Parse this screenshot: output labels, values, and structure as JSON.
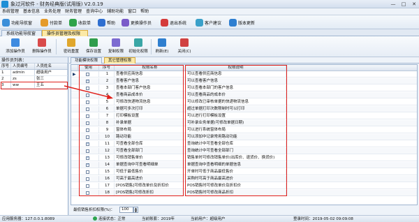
{
  "window": {
    "title": "象过河软件 - 财务经典版(试用版) V2.0.19",
    "minimize": "—",
    "maximize": "□",
    "close": "✕"
  },
  "menu": [
    "系统管理",
    "基本信息",
    "业务处理",
    "财务管理",
    "查询中心",
    "辅助功能",
    "窗口",
    "帮助"
  ],
  "toolbar": [
    {
      "label": "功能导航窗",
      "color": "#3b8fd9"
    },
    {
      "label": "付款单",
      "color": "#e59b2a"
    },
    {
      "label": "收款单",
      "color": "#2fa34a"
    },
    {
      "label": "帮助",
      "color": "#2f6fd0"
    },
    {
      "label": "更换操作员",
      "color": "#7a5bc9"
    },
    {
      "label": "退出系统",
      "color": "#d43b3b"
    },
    {
      "label": "客户建议",
      "color": "#3aa0c9"
    },
    {
      "label": "版本更新",
      "color": "#2e7fd1"
    }
  ],
  "main_tabs": [
    "系统功能导航窗",
    "操作员管理及权限"
  ],
  "ribbon": [
    {
      "label": "添加操作员",
      "color": "#3f8be0"
    },
    {
      "label": "删除操作员",
      "color": "#d94b4b"
    },
    {
      "label": "密码重置",
      "color": "#e0a72c"
    },
    {
      "label": "保存设置",
      "color": "#2f9d4c"
    },
    {
      "label": "复制权限",
      "color": "#7c6bd1"
    },
    {
      "label": "初始化权限",
      "color": "#3aa6a6"
    },
    {
      "label": "刷新(E)",
      "color": "#2f7fcf"
    },
    {
      "label": "关闭(C)",
      "color": "#d04141"
    }
  ],
  "operators": {
    "caption": "操作员列表：",
    "headers": [
      "序号",
      "人员编号",
      "人员姓名"
    ],
    "rows": [
      {
        "num": "1",
        "code": "admin",
        "name": "超级用户"
      },
      {
        "num": "2",
        "code": "zs",
        "name": "张三"
      },
      {
        "num": "3",
        "code": "ww",
        "name": "王五"
      }
    ]
  },
  "sub_tabs": [
    "功能模块权限",
    "其它管理权限"
  ],
  "permissions": {
    "headers": [
      "使用",
      "序号",
      "权限名称",
      "权限说明"
    ],
    "rows": [
      {
        "use": false,
        "num": "1",
        "name": "查看供应商信息",
        "desc": "可以查看供应商信息"
      },
      {
        "use": true,
        "num": "2",
        "name": "查看客户信息",
        "desc": "可以查看客户信息"
      },
      {
        "use": false,
        "num": "3",
        "name": "查看本部门客户信息",
        "desc": "可以查看本部门的客户信息"
      },
      {
        "use": false,
        "num": "4",
        "name": "查看商品成本价",
        "desc": "可以查看商品的成本价"
      },
      {
        "use": false,
        "num": "5",
        "name": "可修改快递物流信息",
        "desc": "可以修改已审核单据的快递物流信息"
      },
      {
        "use": false,
        "num": "6",
        "name": "单据可多次打印",
        "desc": "超过单据打印次数限制时可以打印"
      },
      {
        "use": false,
        "num": "7",
        "name": "打印模板设置",
        "desc": "可以进行打印模板设置"
      },
      {
        "use": false,
        "num": "8",
        "name": "补录单据",
        "desc": "可补录业务单据(可修改单据日期)"
      },
      {
        "use": false,
        "num": "9",
        "name": "窗体布局",
        "desc": "可以进行系统窗体布局"
      },
      {
        "use": false,
        "num": "10",
        "name": "路动功能",
        "desc": "可以添加中记录常用路动功能"
      },
      {
        "use": true,
        "num": "11",
        "name": "可查看全部仓库",
        "desc": "查询统计中可查看全部仓库"
      },
      {
        "use": false,
        "num": "12",
        "name": "可查看全部部门",
        "desc": "查询统计中可查看全部部门"
      },
      {
        "use": true,
        "num": "13",
        "name": "可修改销售单价",
        "desc": "销售单时可修改销售单价(出库价、退货价、换货价)"
      },
      {
        "use": true,
        "num": "14",
        "name": "单据查询中可查看明细单",
        "desc": "单据查询中查看明细的单据信息"
      },
      {
        "use": false,
        "num": "15",
        "name": "可低于最低售价",
        "desc": "开单时可低于商品最低售价"
      },
      {
        "use": false,
        "num": "16",
        "name": "可高于最高进价",
        "desc": "采购时可高于商品最高进价"
      },
      {
        "use": false,
        "num": "17",
        "name": "[POS销售]可修改单价及折扣价",
        "desc": "POS销售时可修改单价及折扣价"
      },
      {
        "use": false,
        "num": "18",
        "name": "[POS销售]可修改折扣",
        "desc": "POS销售时可修改商品折扣"
      }
    ]
  },
  "discount": {
    "label": "最低销售折扣权限(%)：",
    "value": "100",
    "up": "▲",
    "down": "▼"
  },
  "status": {
    "server": "应用服务器：127.0.0.1:8089",
    "connection": "连接状态：正常",
    "account": "当前账套：2019年",
    "user": "当前用户：超级用户",
    "login": "登录时间：2019-05-02 09:09:08"
  }
}
